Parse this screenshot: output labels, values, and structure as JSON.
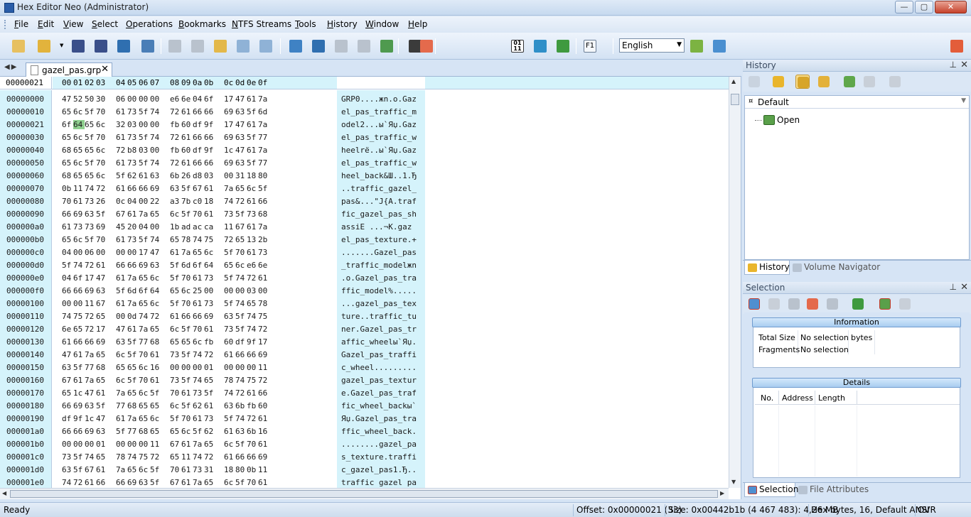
{
  "window": {
    "title": "Hex Editor Neo (Administrator)",
    "buttons": {
      "minimize": "—",
      "maximize": "▢",
      "close": "✕"
    }
  },
  "menu": [
    {
      "label": "File",
      "u": "F",
      "rest": "ile"
    },
    {
      "label": "Edit",
      "u": "E",
      "rest": "dit"
    },
    {
      "label": "View",
      "u": "V",
      "rest": "iew"
    },
    {
      "label": "Select",
      "u": "S",
      "rest": "elect"
    },
    {
      "label": "Operations",
      "u": "O",
      "rest": "perations"
    },
    {
      "label": "Bookmarks",
      "u": "B",
      "rest": "ookmarks"
    },
    {
      "label": "NTFS Streams",
      "u": "N",
      "rest": "TFS Streams"
    },
    {
      "label": "Tools",
      "u": "T",
      "rest": "ools"
    },
    {
      "label": "History",
      "u": "H",
      "rest": "istory"
    },
    {
      "label": "Window",
      "u": "W",
      "rest": "indow"
    },
    {
      "label": "Help",
      "u": "H",
      "rest": "elp"
    }
  ],
  "toolbar": {
    "language": "English",
    "icons": [
      "new-file-icon",
      "open-file-icon",
      "open-dropdown-icon",
      "save-icon",
      "save-as-icon",
      "save-all-icon",
      "print-icon",
      "undo-icon",
      "redo-icon",
      "edit-icon",
      "copy-icon",
      "paste-icon",
      "export-icon",
      "find-icon",
      "find-next-icon",
      "find-previous-icon",
      "find-pattern-icon",
      "bit-view-icon",
      "column-layout-icon",
      "binary-icon",
      "fullscreen-icon",
      "bookmark-icon",
      "help-icon",
      "add-language-icon",
      "languages-icon",
      "rainbow-icon"
    ],
    "help_label": "F1",
    "binary_label": "01\n11"
  },
  "document": {
    "tab_name": "gazel_pas.grp",
    "close_label": "✕",
    "nav_arrows": "◀▶",
    "current_offset": "00000021",
    "column_headers": [
      "00",
      "01",
      "02",
      "03",
      "04",
      "05",
      "06",
      "07",
      "08",
      "09",
      "0a",
      "0b",
      "0c",
      "0d",
      "0e",
      "0f"
    ],
    "selected_row": 2,
    "selected_col": 1,
    "rows": [
      {
        "off": "00000000",
        "hex": [
          "47",
          "52",
          "50",
          "30",
          "06",
          "00",
          "00",
          "00",
          "e6",
          "6e",
          "04",
          "6f",
          "17",
          "47",
          "61",
          "7a"
        ],
        "ascii": "GRP0....жn.o.Gaz"
      },
      {
        "off": "00000010",
        "hex": [
          "65",
          "6c",
          "5f",
          "70",
          "61",
          "73",
          "5f",
          "74",
          "72",
          "61",
          "66",
          "66",
          "69",
          "63",
          "5f",
          "6d"
        ],
        "ascii": "el_pas_traffic_m"
      },
      {
        "off": "00000021",
        "hex": [
          "6f",
          "64",
          "65",
          "6c",
          "32",
          "03",
          "00",
          "00",
          "fb",
          "60",
          "df",
          "9f",
          "17",
          "47",
          "61",
          "7a"
        ],
        "ascii": "odel2...ы`Яџ.Gaz"
      },
      {
        "off": "00000030",
        "hex": [
          "65",
          "6c",
          "5f",
          "70",
          "61",
          "73",
          "5f",
          "74",
          "72",
          "61",
          "66",
          "66",
          "69",
          "63",
          "5f",
          "77"
        ],
        "ascii": "el_pas_traffic_w"
      },
      {
        "off": "00000040",
        "hex": [
          "68",
          "65",
          "65",
          "6c",
          "72",
          "b8",
          "03",
          "00",
          "fb",
          "60",
          "df",
          "9f",
          "1c",
          "47",
          "61",
          "7a"
        ],
        "ascii": "heelrё..ы`Яџ.Gaz"
      },
      {
        "off": "00000050",
        "hex": [
          "65",
          "6c",
          "5f",
          "70",
          "61",
          "73",
          "5f",
          "74",
          "72",
          "61",
          "66",
          "66",
          "69",
          "63",
          "5f",
          "77"
        ],
        "ascii": "el_pas_traffic_w"
      },
      {
        "off": "00000060",
        "hex": [
          "68",
          "65",
          "65",
          "6c",
          "5f",
          "62",
          "61",
          "63",
          "6b",
          "26",
          "d8",
          "03",
          "00",
          "31",
          "18",
          "80"
        ],
        "ascii": "heel_back&Ш..1.Ђ"
      },
      {
        "off": "00000070",
        "hex": [
          "0b",
          "11",
          "74",
          "72",
          "61",
          "66",
          "66",
          "69",
          "63",
          "5f",
          "67",
          "61",
          "7a",
          "65",
          "6c",
          "5f"
        ],
        "ascii": "..traffic_gazel_"
      },
      {
        "off": "00000080",
        "hex": [
          "70",
          "61",
          "73",
          "26",
          "0c",
          "04",
          "00",
          "22",
          "a3",
          "7b",
          "c0",
          "18",
          "74",
          "72",
          "61",
          "66"
        ],
        "ascii": "pas&...\"Ј{А.traf"
      },
      {
        "off": "00000090",
        "hex": [
          "66",
          "69",
          "63",
          "5f",
          "67",
          "61",
          "7a",
          "65",
          "6c",
          "5f",
          "70",
          "61",
          "73",
          "5f",
          "73",
          "68"
        ],
        "ascii": "fic_gazel_pas_sh"
      },
      {
        "off": "000000a0",
        "hex": [
          "61",
          "73",
          "73",
          "69",
          "45",
          "20",
          "04",
          "00",
          "1b",
          "ad",
          "ac",
          "ca",
          "11",
          "67",
          "61",
          "7a"
        ],
        "ascii": "assiE ...­¬К.gaz"
      },
      {
        "off": "000000b0",
        "hex": [
          "65",
          "6c",
          "5f",
          "70",
          "61",
          "73",
          "5f",
          "74",
          "65",
          "78",
          "74",
          "75",
          "72",
          "65",
          "13",
          "2b"
        ],
        "ascii": "el_pas_texture.+"
      },
      {
        "off": "000000c0",
        "hex": [
          "04",
          "00",
          "06",
          "00",
          "00",
          "00",
          "17",
          "47",
          "61",
          "7a",
          "65",
          "6c",
          "5f",
          "70",
          "61",
          "73"
        ],
        "ascii": ".......Gazel_pas"
      },
      {
        "off": "000000d0",
        "hex": [
          "5f",
          "74",
          "72",
          "61",
          "66",
          "66",
          "69",
          "63",
          "5f",
          "6d",
          "6f",
          "64",
          "65",
          "6c",
          "e6",
          "6e"
        ],
        "ascii": "_traffic_modelжn"
      },
      {
        "off": "000000e0",
        "hex": [
          "04",
          "6f",
          "17",
          "47",
          "61",
          "7a",
          "65",
          "6c",
          "5f",
          "70",
          "61",
          "73",
          "5f",
          "74",
          "72",
          "61"
        ],
        "ascii": ".o.Gazel_pas_tra"
      },
      {
        "off": "000000f0",
        "hex": [
          "66",
          "66",
          "69",
          "63",
          "5f",
          "6d",
          "6f",
          "64",
          "65",
          "6c",
          "25",
          "00",
          "00",
          "00",
          "03",
          "00"
        ],
        "ascii": "ffic_model%....."
      },
      {
        "off": "00000100",
        "hex": [
          "00",
          "00",
          "11",
          "67",
          "61",
          "7a",
          "65",
          "6c",
          "5f",
          "70",
          "61",
          "73",
          "5f",
          "74",
          "65",
          "78"
        ],
        "ascii": "...gazel_pas_tex"
      },
      {
        "off": "00000110",
        "hex": [
          "74",
          "75",
          "72",
          "65",
          "00",
          "0d",
          "74",
          "72",
          "61",
          "66",
          "66",
          "69",
          "63",
          "5f",
          "74",
          "75"
        ],
        "ascii": "ture..traffic_tu"
      },
      {
        "off": "00000120",
        "hex": [
          "6e",
          "65",
          "72",
          "17",
          "47",
          "61",
          "7a",
          "65",
          "6c",
          "5f",
          "70",
          "61",
          "73",
          "5f",
          "74",
          "72"
        ],
        "ascii": "ner.Gazel_pas_tr"
      },
      {
        "off": "00000130",
        "hex": [
          "61",
          "66",
          "66",
          "69",
          "63",
          "5f",
          "77",
          "68",
          "65",
          "65",
          "6c",
          "fb",
          "60",
          "df",
          "9f",
          "17"
        ],
        "ascii": "affic_wheelы`Яџ."
      },
      {
        "off": "00000140",
        "hex": [
          "47",
          "61",
          "7a",
          "65",
          "6c",
          "5f",
          "70",
          "61",
          "73",
          "5f",
          "74",
          "72",
          "61",
          "66",
          "66",
          "69"
        ],
        "ascii": "Gazel_pas_traffi"
      },
      {
        "off": "00000150",
        "hex": [
          "63",
          "5f",
          "77",
          "68",
          "65",
          "65",
          "6c",
          "16",
          "00",
          "00",
          "00",
          "01",
          "00",
          "00",
          "00",
          "11"
        ],
        "ascii": "c_wheel........."
      },
      {
        "off": "00000160",
        "hex": [
          "67",
          "61",
          "7a",
          "65",
          "6c",
          "5f",
          "70",
          "61",
          "73",
          "5f",
          "74",
          "65",
          "78",
          "74",
          "75",
          "72"
        ],
        "ascii": "gazel_pas_textur"
      },
      {
        "off": "00000170",
        "hex": [
          "65",
          "1c",
          "47",
          "61",
          "7a",
          "65",
          "6c",
          "5f",
          "70",
          "61",
          "73",
          "5f",
          "74",
          "72",
          "61",
          "66"
        ],
        "ascii": "e.Gazel_pas_traf"
      },
      {
        "off": "00000180",
        "hex": [
          "66",
          "69",
          "63",
          "5f",
          "77",
          "68",
          "65",
          "65",
          "6c",
          "5f",
          "62",
          "61",
          "63",
          "6b",
          "fb",
          "60"
        ],
        "ascii": "fic_wheel_backы`"
      },
      {
        "off": "00000190",
        "hex": [
          "df",
          "9f",
          "1c",
          "47",
          "61",
          "7a",
          "65",
          "6c",
          "5f",
          "70",
          "61",
          "73",
          "5f",
          "74",
          "72",
          "61"
        ],
        "ascii": "Яџ.Gazel_pas_tra"
      },
      {
        "off": "000001a0",
        "hex": [
          "66",
          "66",
          "69",
          "63",
          "5f",
          "77",
          "68",
          "65",
          "65",
          "6c",
          "5f",
          "62",
          "61",
          "63",
          "6b",
          "16"
        ],
        "ascii": "ffic_wheel_back."
      },
      {
        "off": "000001b0",
        "hex": [
          "00",
          "00",
          "00",
          "01",
          "00",
          "00",
          "00",
          "11",
          "67",
          "61",
          "7a",
          "65",
          "6c",
          "5f",
          "70",
          "61"
        ],
        "ascii": "........gazel_pa"
      },
      {
        "off": "000001c0",
        "hex": [
          "73",
          "5f",
          "74",
          "65",
          "78",
          "74",
          "75",
          "72",
          "65",
          "11",
          "74",
          "72",
          "61",
          "66",
          "66",
          "69"
        ],
        "ascii": "s_texture.traffi"
      },
      {
        "off": "000001d0",
        "hex": [
          "63",
          "5f",
          "67",
          "61",
          "7a",
          "65",
          "6c",
          "5f",
          "70",
          "61",
          "73",
          "31",
          "18",
          "80",
          "0b",
          "11"
        ],
        "ascii": "c_gazel_pas1.Ђ.."
      },
      {
        "off": "000001e0",
        "hex": [
          "74",
          "72",
          "61",
          "66",
          "66",
          "69",
          "63",
          "5f",
          "67",
          "61",
          "7a",
          "65",
          "6c",
          "5f",
          "70",
          "61"
        ],
        "ascii": "traffic gazel pa"
      }
    ]
  },
  "history_panel": {
    "title": "History",
    "default_tab": "Default",
    "entries": [
      "Open"
    ],
    "tabs": [
      "History",
      "Volume Navigator"
    ]
  },
  "selection_panel": {
    "title": "Selection",
    "information_title": "Information",
    "info": [
      {
        "label": "Total Size",
        "value": "No selection",
        "unit": "bytes"
      },
      {
        "label": "Fragments",
        "value": "No selection",
        "unit": ""
      }
    ],
    "details_title": "Details",
    "details_columns": [
      "No.",
      "Address",
      "Length"
    ],
    "tabs": [
      "Selection",
      "File Attributes"
    ]
  },
  "status": {
    "ready": "Ready",
    "offset": "Offset: 0x00000021 (33)",
    "size": "Size: 0x00442b1b (4 467 483): 4,26 MB",
    "mode": "Hex bytes, 16, Default ANSI",
    "ovr": "OVR"
  }
}
